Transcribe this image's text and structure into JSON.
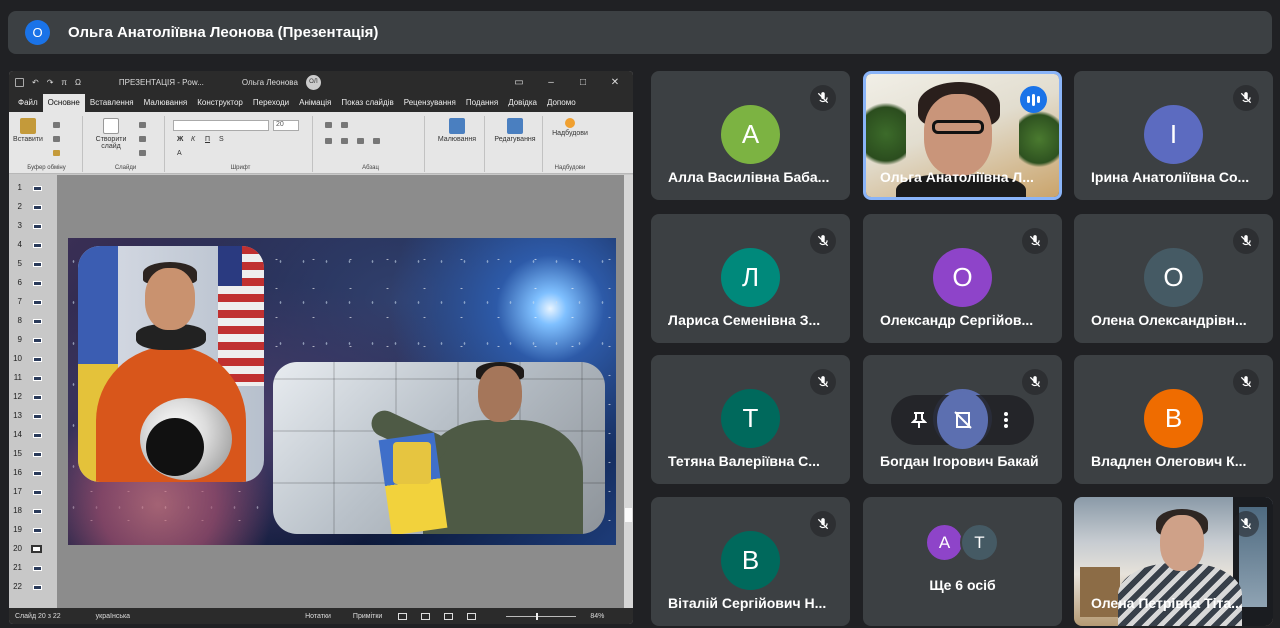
{
  "header": {
    "avatar_letter": "О",
    "avatar_color": "#1a73e8",
    "title": "Ольга Анатоліївна Леонова (Презентація)"
  },
  "presentation": {
    "titlebar": {
      "doc_title": "ПРЕЗЕНТАЦІЯ - Pow...",
      "user_name": "Ольга Леонова",
      "user_initials": "ОЛ"
    },
    "tabs": [
      "Файл",
      "Основне",
      "Вставлення",
      "Малювання",
      "Конструктор",
      "Переходи",
      "Анімація",
      "Показ слайдів",
      "Рецензування",
      "Подання",
      "Довідка",
      "Допомо"
    ],
    "active_tab": "Основне",
    "ribbon": {
      "paste": "Вставити",
      "new_slide": "Створити слайд",
      "font_size": "20",
      "drawing": "Малювання",
      "editing": "Редагування",
      "addins": "Надбудови",
      "groups": [
        "Буфер обміну",
        "Слайди",
        "Шрифт",
        "Абзац",
        "Надбудови"
      ]
    },
    "thumbnails": [
      "1",
      "2",
      "3",
      "4",
      "5",
      "6",
      "7",
      "8",
      "9",
      "10",
      "11",
      "12",
      "13",
      "14",
      "15",
      "16",
      "17",
      "18",
      "19",
      "20",
      "21",
      "22"
    ],
    "selected_slide": "20",
    "status": {
      "slide_info": "Слайд 20 з 22",
      "language": "українська",
      "notes": "Нотатки",
      "comments": "Примітки",
      "zoom": "84%"
    }
  },
  "participants": [
    {
      "name": "Алла Василівна Баба...",
      "letter": "А",
      "color": "#7cb342",
      "muted": true
    },
    {
      "name": "Ольга Анатоліївна Л...",
      "video": true,
      "speaking": true
    },
    {
      "name": "Ірина Анатоліївна Со...",
      "letter": "І",
      "color": "#5c6bc0",
      "muted": true
    },
    {
      "name": "Лариса Семенівна З...",
      "letter": "Л",
      "color": "#00897b",
      "muted": true
    },
    {
      "name": "Олександр Сергійов...",
      "letter": "О",
      "color": "#8e44c9",
      "muted": true
    },
    {
      "name": "Олена Олександрівн...",
      "letter": "О",
      "color": "#455a64",
      "muted": true
    },
    {
      "name": "Тетяна Валеріївна С...",
      "letter": "Т",
      "color": "#00695c",
      "muted": true
    },
    {
      "name": "Богдан Ігорович Бакай",
      "letter": "",
      "color": "#5c6fb0",
      "muted": true
    },
    {
      "name": "Владлен Олегович К...",
      "letter": "В",
      "color": "#ef6c00",
      "muted": true
    },
    {
      "name": "Віталій Сергійович Н...",
      "letter": "В",
      "color": "#00695c",
      "muted": true
    },
    {
      "others_label": "Ще 6 осіб",
      "avatars": [
        {
          "letter": "А",
          "color": "#8e44c9"
        },
        {
          "letter": "Т",
          "color": "#455a64"
        }
      ]
    },
    {
      "name": "Олена Петрівна Тіта...",
      "video": true,
      "muted": true
    }
  ]
}
